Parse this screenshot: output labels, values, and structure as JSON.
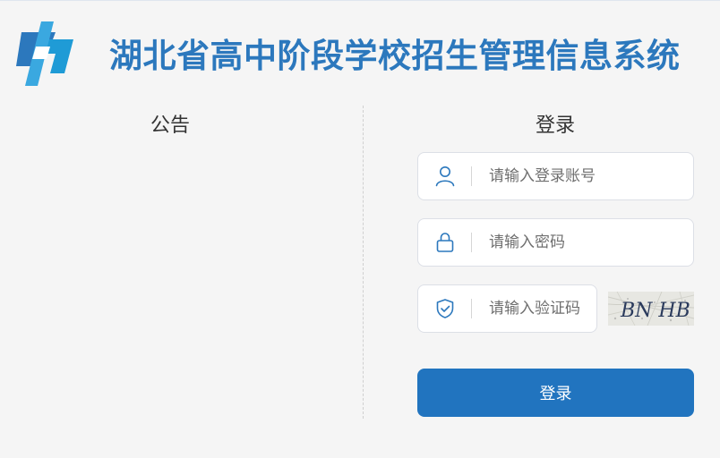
{
  "header": {
    "title": "湖北省高中阶段学校招生管理信息系统",
    "logo_icon": "zhong-logo-icon",
    "brand_color": "#2c78bd"
  },
  "notice": {
    "title": "公告"
  },
  "login": {
    "title": "登录",
    "username": {
      "placeholder": "请输入登录账号",
      "icon": "user-icon"
    },
    "password": {
      "placeholder": "请输入密码",
      "icon": "lock-icon"
    },
    "captcha": {
      "placeholder": "请输入验证码",
      "icon": "shield-check-icon",
      "code": "BN HB"
    },
    "submit_label": "登录",
    "button_color": "#2174bf"
  }
}
